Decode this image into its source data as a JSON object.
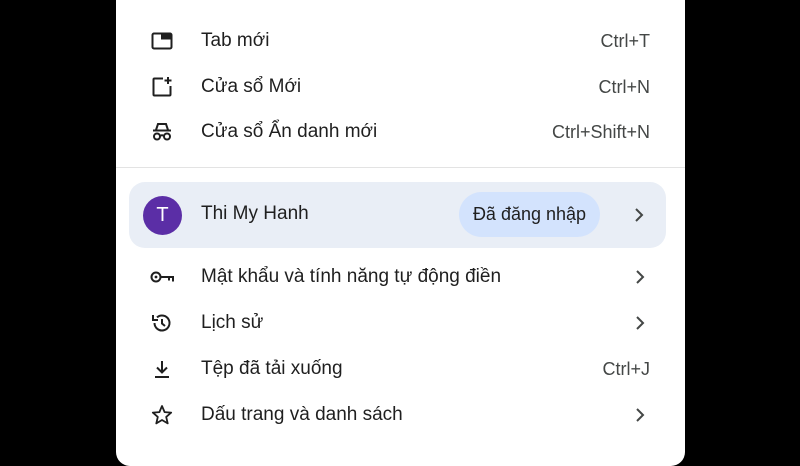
{
  "menu": {
    "new_tab": {
      "label": "Tab mới",
      "shortcut": "Ctrl+T",
      "icon": "new-tab-icon"
    },
    "new_window": {
      "label": "Cửa sổ Mới",
      "shortcut": "Ctrl+N",
      "icon": "new-window-icon"
    },
    "incognito": {
      "label": "Cửa sổ Ẩn danh mới",
      "shortcut": "Ctrl+Shift+N",
      "icon": "incognito-icon"
    },
    "profile": {
      "avatar_letter": "T",
      "name": "Thi My Hanh",
      "status": "Đã đăng nhập",
      "avatar_color": "#5b2ea6",
      "highlight_color": "#e9eef6",
      "badge_color": "#d3e3fd"
    },
    "passwords": {
      "label": "Mật khẩu và tính năng tự động điền",
      "icon": "key-icon"
    },
    "history": {
      "label": "Lịch sử",
      "icon": "history-icon"
    },
    "downloads": {
      "label": "Tệp đã tải xuống",
      "shortcut": "Ctrl+J",
      "icon": "download-icon"
    },
    "bookmarks": {
      "label": "Dấu trang và danh sách",
      "icon": "star-icon"
    }
  }
}
